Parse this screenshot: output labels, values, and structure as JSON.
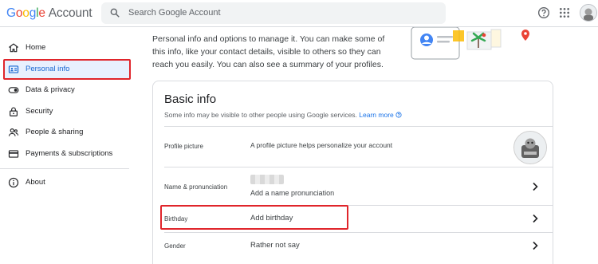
{
  "header": {
    "logo_google": "Google",
    "logo_account": "Account",
    "search_placeholder": "Search Google Account",
    "icons": [
      "search-icon",
      "help-icon",
      "apps-grid-icon",
      "profile-avatar"
    ]
  },
  "sidebar": {
    "items": [
      {
        "label": "Home",
        "icon": "home-icon",
        "active": false
      },
      {
        "label": "Personal info",
        "icon": "id-card-icon",
        "active": true
      },
      {
        "label": "Data & privacy",
        "icon": "toggle-icon",
        "active": false
      },
      {
        "label": "Security",
        "icon": "lock-icon",
        "active": false
      },
      {
        "label": "People & sharing",
        "icon": "people-icon",
        "active": false
      },
      {
        "label": "Payments & subscriptions",
        "icon": "card-icon",
        "active": false
      },
      {
        "label": "About",
        "icon": "info-icon",
        "active": false
      }
    ]
  },
  "main": {
    "intro_lines": [
      "Personal info and options to manage it. You can make some of",
      "this info, like your contact details, visible to others so they can",
      "reach you easily. You can also see a summary of your profiles."
    ]
  },
  "basic_info": {
    "title": "Basic info",
    "subtitle": "Some info may be visible to other people using Google services.",
    "learn_more": "Learn more",
    "rows": [
      {
        "label": "Profile picture",
        "value": "A profile picture helps personalize your account"
      },
      {
        "label": "Name & pronunciation",
        "value": "Add a name pronunciation"
      },
      {
        "label": "Birthday",
        "value": "Add birthday"
      },
      {
        "label": "Gender",
        "value": "Rather not say"
      }
    ]
  },
  "colors": {
    "accent_blue": "#1a73e8",
    "active_bg": "#e8f0fe",
    "annotation_red": "#e0252b"
  }
}
